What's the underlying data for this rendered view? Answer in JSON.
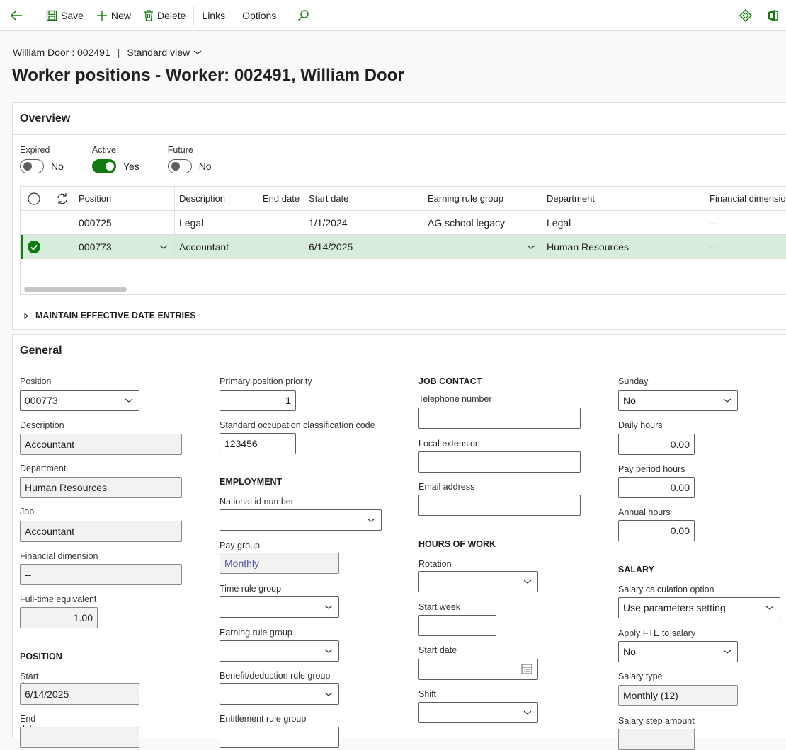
{
  "toolbar": {
    "save": "Save",
    "new": "New",
    "delete": "Delete",
    "links": "Links",
    "options": "Options"
  },
  "header": {
    "breadcrumb": "William Door : 002491",
    "separator": "|",
    "view": "Standard view",
    "title": "Worker positions - Worker: 002491, William Door"
  },
  "overview": {
    "title": "Overview",
    "filters": [
      {
        "label": "Expired",
        "value": "No",
        "on": false
      },
      {
        "label": "Active",
        "value": "Yes",
        "on": true
      },
      {
        "label": "Future",
        "value": "No",
        "on": false
      }
    ],
    "columns": [
      "Position",
      "Description",
      "End date",
      "Start date",
      "Earning rule group",
      "Department",
      "Financial dimension"
    ],
    "rows": [
      {
        "position": "000725",
        "description": "Legal",
        "end_date": "",
        "start_date": "1/1/2024",
        "earning_rule_group": "AG school legacy",
        "department": "Legal",
        "financial_dimension": "--"
      },
      {
        "position": "000773",
        "description": "Accountant",
        "end_date": "",
        "start_date": "6/14/2025",
        "earning_rule_group": "",
        "department": "Human Resources",
        "financial_dimension": "--"
      }
    ],
    "maintain_label": "MAINTAIN EFFECTIVE DATE ENTRIES"
  },
  "general": {
    "title": "General",
    "col1": {
      "position_label": "Position",
      "position_value": "000773",
      "description_label": "Description",
      "description_value": "Accountant",
      "department_label": "Department",
      "department_value": "Human Resources",
      "job_label": "Job",
      "job_value": "Accountant",
      "findim_label": "Financial dimension",
      "findim_value": "--",
      "fte_label": "Full-time equivalent",
      "fte_value": "1.00",
      "position_section": "POSITION",
      "start_date_label": "Start date",
      "start_date_value": "6/14/2025",
      "end_date_label": "End date"
    },
    "col2": {
      "priority_label": "Primary position priority",
      "priority_value": "1",
      "soc_label": "Standard occupation classification code",
      "soc_value": "123456",
      "employment_section": "EMPLOYMENT",
      "national_id_label": "National id number",
      "pay_group_label": "Pay group",
      "pay_group_value": "Monthly",
      "time_rule_label": "Time rule group",
      "earning_rule_label": "Earning rule group",
      "benefit_label": "Benefit/deduction rule group",
      "entitlement_label": "Entitlement rule group"
    },
    "col3": {
      "job_contact_section": "JOB CONTACT",
      "telephone_label": "Telephone number",
      "local_ext_label": "Local extension",
      "email_label": "Email address",
      "hours_section": "HOURS OF WORK",
      "rotation_label": "Rotation",
      "start_week_label": "Start week",
      "start_date_label": "Start date",
      "shift_label": "Shift"
    },
    "col4": {
      "sunday_label": "Sunday",
      "sunday_value": "No",
      "daily_hours_label": "Daily hours",
      "daily_hours_value": "0.00",
      "pay_period_hours_label": "Pay period hours",
      "pay_period_hours_value": "0.00",
      "annual_hours_label": "Annual hours",
      "annual_hours_value": "0.00",
      "salary_section": "SALARY",
      "salary_calc_label": "Salary calculation option",
      "salary_calc_value": "Use parameters setting",
      "apply_fte_label": "Apply FTE to salary",
      "apply_fte_value": "No",
      "salary_type_label": "Salary type",
      "salary_type_value": "Monthly (12)",
      "salary_step_label": "Salary step amount"
    }
  },
  "colors": {
    "accent": "#107c10",
    "selected_row": "#d8ecdb",
    "link": "#4f52b2"
  }
}
